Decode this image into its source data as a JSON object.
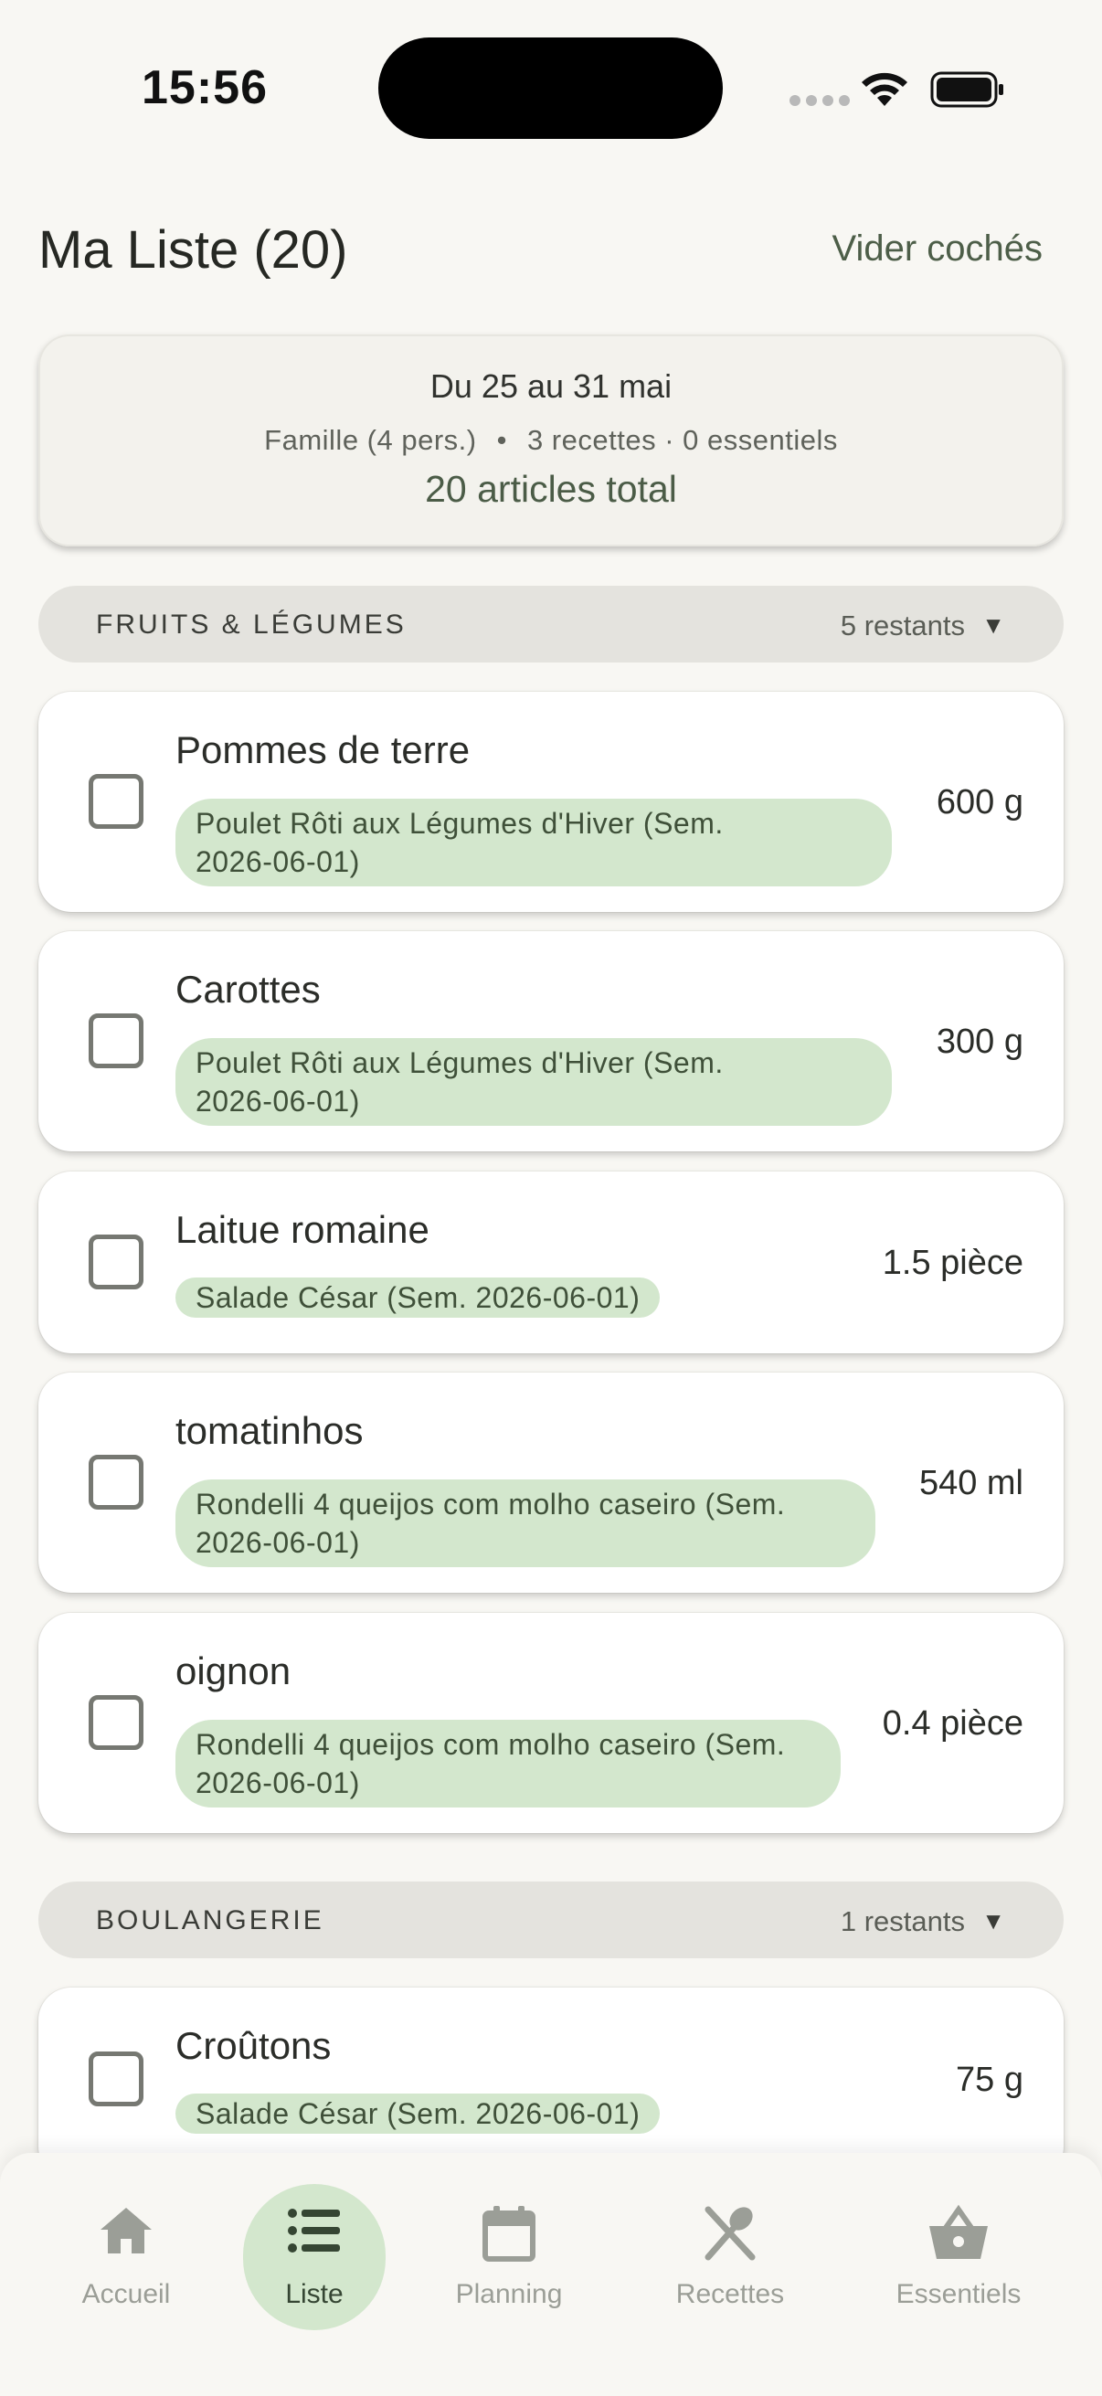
{
  "status_bar": {
    "time": "15:56"
  },
  "header": {
    "title": "Ma Liste (20)",
    "clear_label": "Vider cochés"
  },
  "summary": {
    "dates": "Du 25 au 31 mai",
    "household": "Famille (4 pers.)",
    "separator": "•",
    "recipes_essentials": "3 recettes · 0 essentiels",
    "total": "20 articles total"
  },
  "categories": [
    {
      "name": "FRUITS & LÉGUMES",
      "count": "5 restants",
      "chevron": "▼",
      "items": [
        {
          "name": "Pommes de terre",
          "tag_line1": "Poulet Rôti aux Légumes d'Hiver (Sem.",
          "tag_line2": "2026-06-01)",
          "qty": "600 g",
          "checked": false
        },
        {
          "name": "Carottes",
          "tag_line1": "Poulet Rôti aux Légumes d'Hiver (Sem.",
          "tag_line2": "2026-06-01)",
          "qty": "300 g",
          "checked": false
        },
        {
          "name": "Laitue romaine",
          "tag_line1": "Salade César (Sem. 2026-06-01)",
          "qty": "1.5 pièce",
          "checked": false
        },
        {
          "name": "tomatinhos",
          "tag_line1": "Rondelli 4 queijos com molho caseiro (Sem.",
          "tag_line2": "2026-06-01)",
          "qty": "540 ml",
          "checked": false
        },
        {
          "name": "oignon",
          "tag_line1": "Rondelli 4 queijos com molho caseiro (Sem.",
          "tag_line2": "2026-06-01)",
          "qty": "0.4 pièce",
          "checked": false
        }
      ]
    },
    {
      "name": "BOULANGERIE",
      "count": "1 restants",
      "chevron": "▼",
      "items": [
        {
          "name": "Croûtons",
          "tag_line1": "Salade César (Sem. 2026-06-01)",
          "qty": "75 g",
          "checked": false
        }
      ]
    }
  ],
  "nav": [
    {
      "label": "Accueil",
      "icon": "home-icon"
    },
    {
      "label": "Liste",
      "icon": "list-icon",
      "active": true
    },
    {
      "label": "Planning",
      "icon": "calendar-icon"
    },
    {
      "label": "Recettes",
      "icon": "utensils-icon"
    },
    {
      "label": "Essentiels",
      "icon": "basket-icon"
    }
  ],
  "colors": {
    "background": "#f8f7f3",
    "accent_green": "#4b5c47",
    "tag_background": "#d3e7cd",
    "category_background": "#e4e3de"
  }
}
